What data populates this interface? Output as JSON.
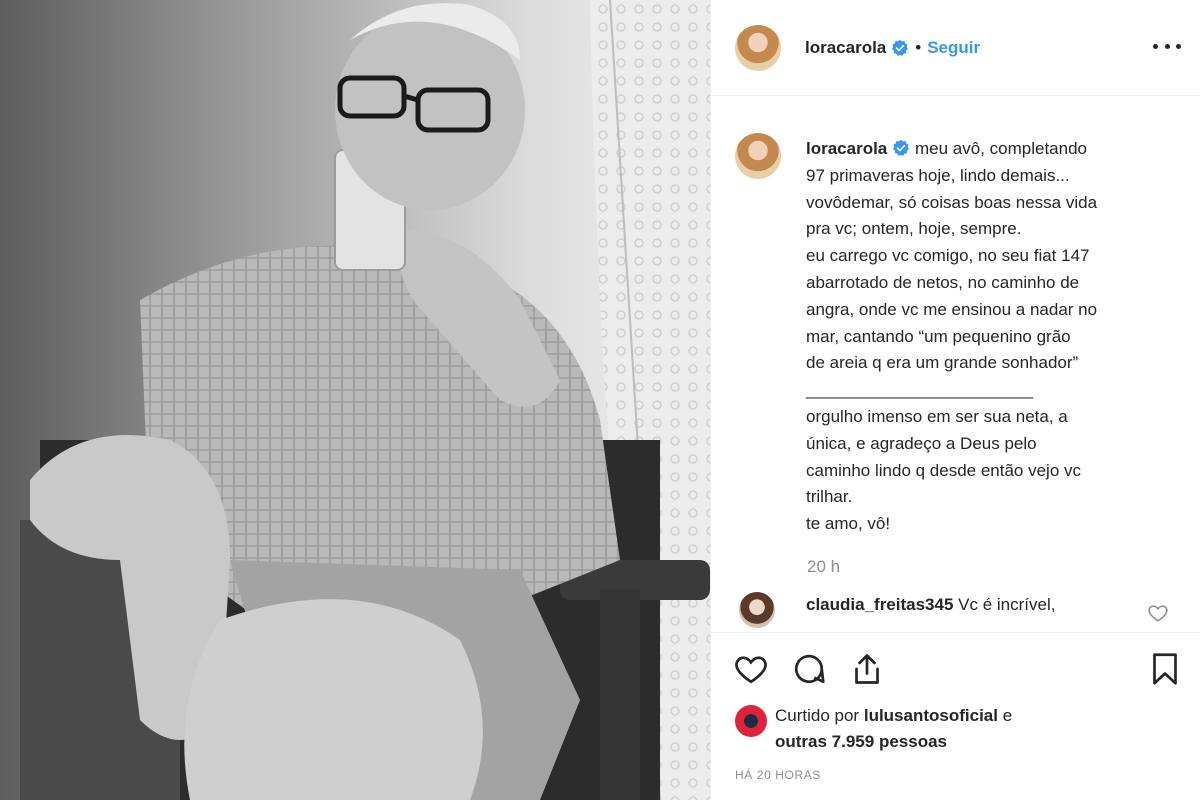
{
  "post": {
    "username": "loracarola",
    "follow_label": "Seguir",
    "separator": "•",
    "caption": {
      "username": "loracarola",
      "lines": [
        "meu avô, completando",
        "97 primaveras hoje, lindo demais...",
        "vovôdemar, só coisas boas nessa vida",
        "pra vc; ontem, hoje, sempre.",
        "eu carrego vc comigo, no seu fiat 147",
        "abarrotado de netos, no caminho de",
        "angra, onde vc me ensinou a nadar no",
        "mar, cantando “um pequenino grão",
        "de areia q era um grande sonhador”",
        "________________________",
        "orgulho imenso em ser sua neta, a",
        "única, e agradeço a Deus pelo",
        "caminho lindo q desde então vejo vc",
        "trilhar.",
        "te amo, vô!"
      ]
    },
    "timestamp": "20 h",
    "comment": {
      "username": "claudia_freitas345",
      "text": "Vc é incrível,"
    },
    "likes": {
      "prefix": "Curtido por",
      "liker": "lulusantosoficial",
      "and": "e",
      "count_text": "outras 7.959 pessoas"
    },
    "date": "HÁ 20 HORAS"
  },
  "icons": {
    "verified": "verified-badge-icon",
    "more": "more-options-icon",
    "like": "heart-icon",
    "comment": "comment-bubble-icon",
    "share": "share-icon",
    "save": "bookmark-icon"
  },
  "colors": {
    "accent": "#3897f0",
    "text": "#262626",
    "muted": "#8e8e8e",
    "border": "#efefef"
  }
}
